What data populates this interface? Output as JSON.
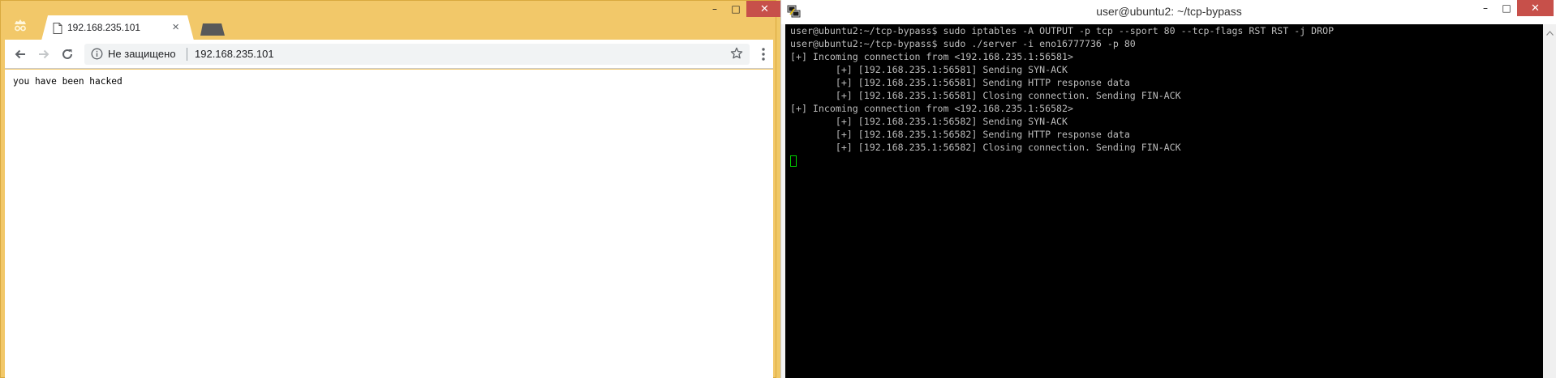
{
  "browser": {
    "tab": {
      "title": "192.168.235.101"
    },
    "toolbar": {
      "security_label": "Не защищено",
      "url": "192.168.235.101"
    },
    "page": {
      "text": "you have been hacked"
    },
    "window_controls": {
      "minimize": "–",
      "maximize": "□",
      "close": "✕"
    }
  },
  "terminal": {
    "title": "user@ubuntu2: ~/tcp-bypass",
    "window_controls": {
      "minimize": "–",
      "maximize": "□",
      "close": "✕"
    },
    "lines": [
      "user@ubuntu2:~/tcp-bypass$ sudo iptables -A OUTPUT -p tcp --sport 80 --tcp-flags RST RST -j DROP",
      "user@ubuntu2:~/tcp-bypass$ sudo ./server -i eno16777736 -p 80",
      "[+] Incoming connection from <192.168.235.1:56581>",
      "        [+] [192.168.235.1:56581] Sending SYN-ACK",
      "        [+] [192.168.235.1:56581] Sending HTTP response data",
      "        [+] [192.168.235.1:56581] Closing connection. Sending FIN-ACK",
      "[+] Incoming connection from <192.168.235.1:56582>",
      "        [+] [192.168.235.1:56582] Sending SYN-ACK",
      "        [+] [192.168.235.1:56582] Sending HTTP response data",
      "        [+] [192.168.235.1:56582] Closing connection. Sending FIN-ACK"
    ]
  },
  "icons": {
    "incognito": "incognito-icon",
    "favicon": "page-icon",
    "back": "arrow-left-icon",
    "forward": "arrow-right-icon",
    "reload": "reload-icon",
    "info": "info-icon",
    "bookmark": "star-icon",
    "menu": "more-vert-icon",
    "putty": "putty-icon"
  },
  "colors": {
    "browser_frame": "#f2c869",
    "terminal_bg": "#000000",
    "terminal_text": "#bbbbbb",
    "cursor": "#00d000",
    "close_button": "#c7504a"
  }
}
